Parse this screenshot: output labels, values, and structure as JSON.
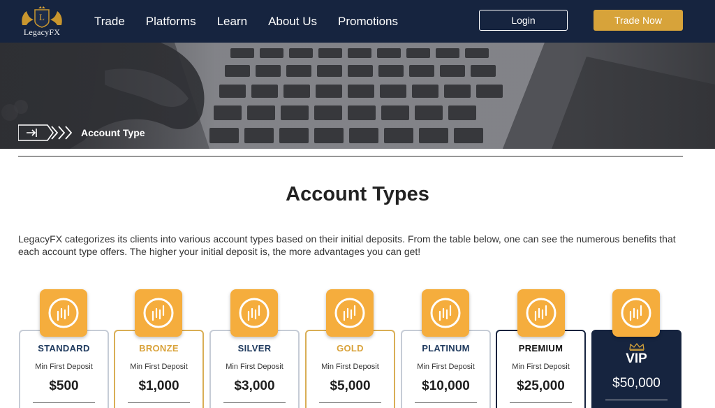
{
  "header": {
    "logo_text": "LegacyFX",
    "nav": [
      "Trade",
      "Platforms",
      "Learn",
      "About Us",
      "Promotions"
    ],
    "login_label": "Login",
    "trade_now_label": "Trade Now"
  },
  "hero": {
    "breadcrumb": "Account Type"
  },
  "main": {
    "title": "Account Types",
    "intro": "LegacyFX categorizes its clients into various account types based on their initial deposits. From the table below, one can see the numerous benefits that each account type offers. The higher your initial deposit is, the more advantages you can get!"
  },
  "accounts": [
    {
      "name": "STANDARD",
      "label": "Min First Deposit",
      "deposit": "$500",
      "color": "#1f3a5e"
    },
    {
      "name": "BRONZE",
      "label": "Min First Deposit",
      "deposit": "$1,000",
      "color": "#d9a23a"
    },
    {
      "name": "SILVER",
      "label": "Min First Deposit",
      "deposit": "$3,000",
      "color": "#1f3a5e"
    },
    {
      "name": "GOLD",
      "label": "Min First Deposit",
      "deposit": "$5,000",
      "color": "#d9a23a"
    },
    {
      "name": "PLATINUM",
      "label": "Min First Deposit",
      "deposit": "$10,000",
      "color": "#1f3a5e"
    },
    {
      "name": "PREMIUM",
      "label": "Min First Deposit",
      "deposit": "$25,000",
      "color": "#111111"
    },
    {
      "name": "VIP",
      "deposit": "$50,000",
      "color": "#ffffff"
    }
  ],
  "icons": {
    "account_icon": "candlestick-chart-icon",
    "vip_icon": "crown-icon",
    "breadcrumb_icon": "enter-chevrons-icon"
  },
  "colors": {
    "navy": "#16243f",
    "gold": "#d7a33a",
    "icon_orange": "#f5ad3d"
  }
}
